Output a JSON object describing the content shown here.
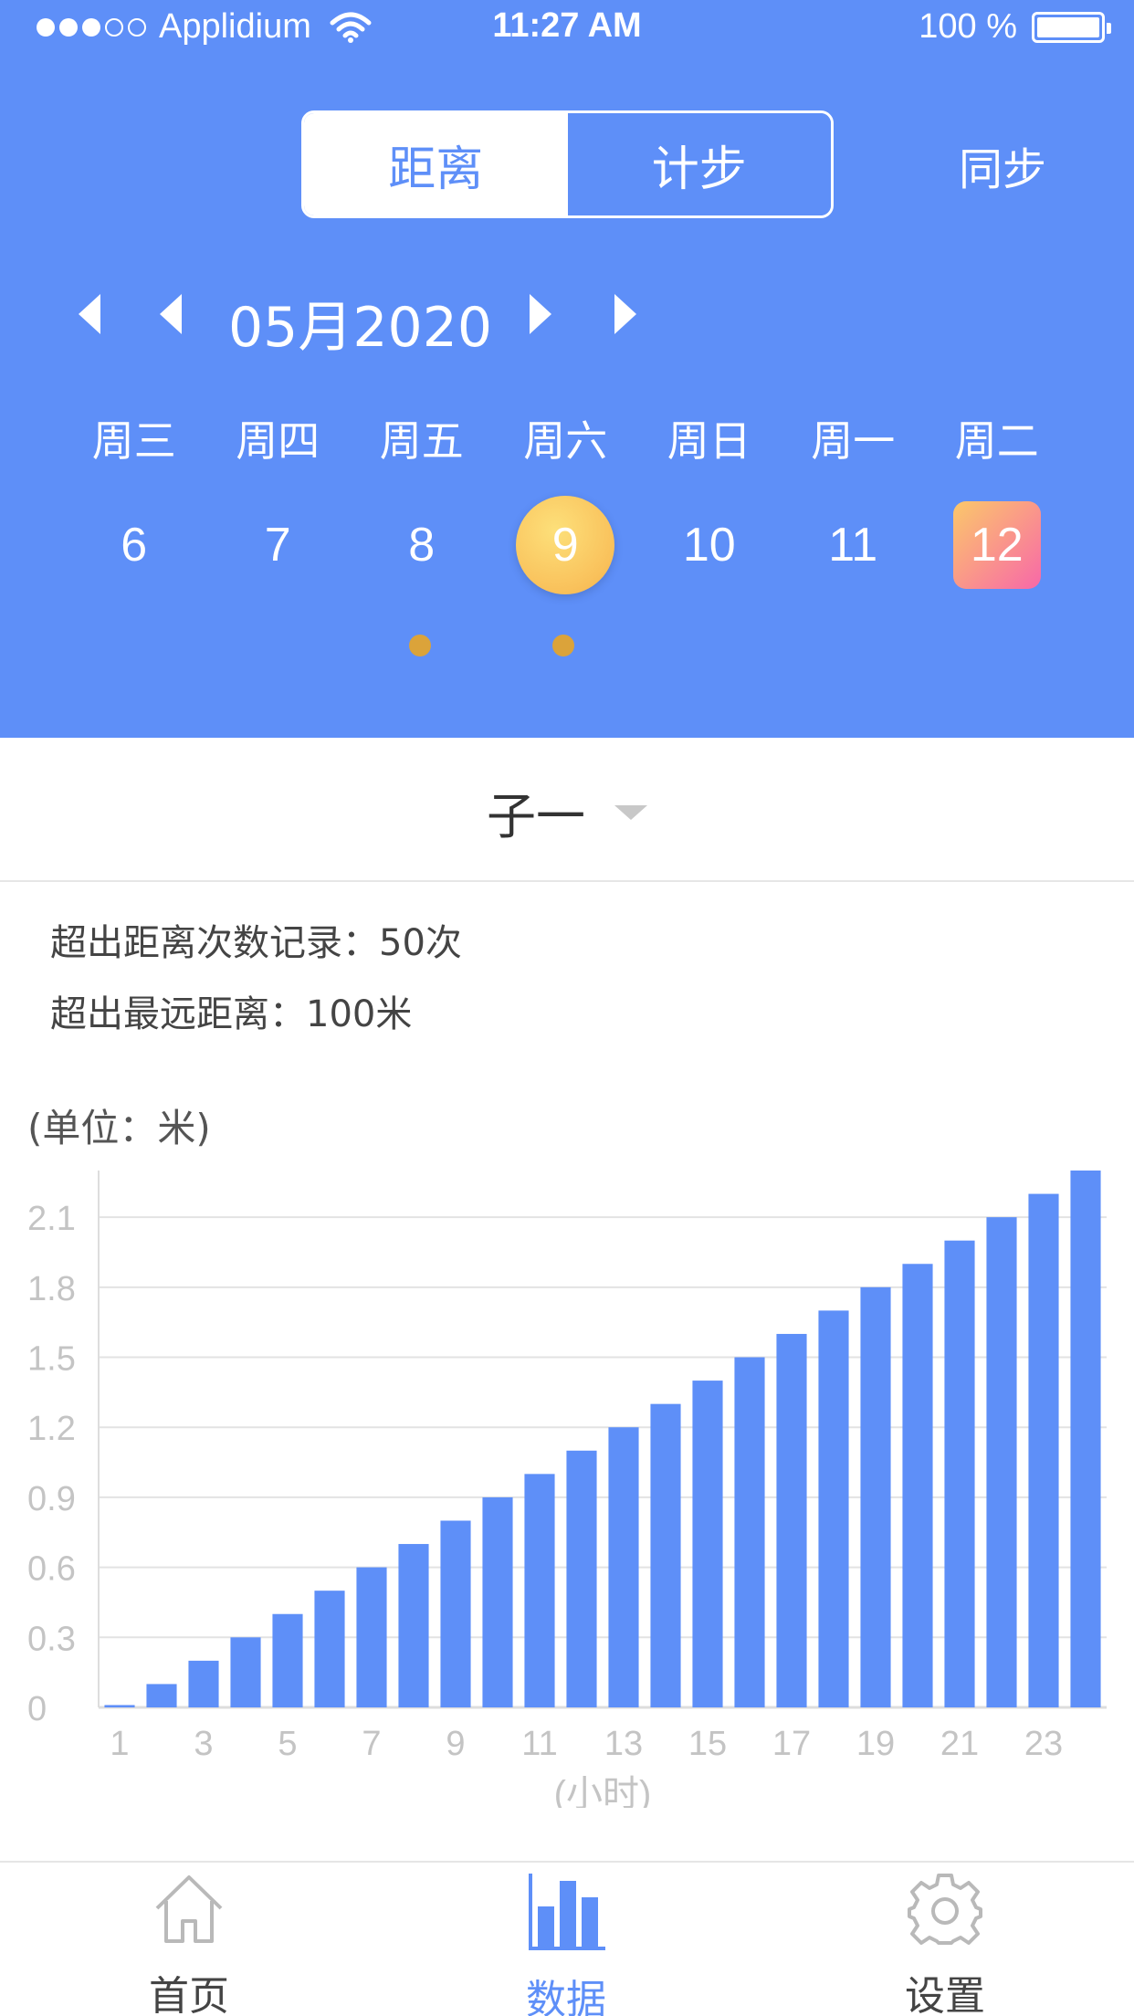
{
  "status_bar": {
    "carrier": "Applidium",
    "time": "11:27 AM",
    "battery": "100 %"
  },
  "segment": {
    "tabs": [
      "距离",
      "计步"
    ],
    "active_index": 0
  },
  "sync_label": "同步",
  "month_label": "05月2020",
  "weekdays": [
    "周三",
    "周四",
    "周五",
    "周六",
    "周日",
    "周一",
    "周二"
  ],
  "days": [
    "6",
    "7",
    "8",
    "9",
    "10",
    "11",
    "12"
  ],
  "selected_day": "9",
  "today_day": "12",
  "marked_days": [
    "8",
    "9"
  ],
  "selector": {
    "name": "子一"
  },
  "stats": {
    "exceed_count": "超出距离次数记录：50次",
    "max_distance": "超出最远距离：100米"
  },
  "unit_label": "(单位：米)",
  "colors": {
    "brand": "#5e8ff8",
    "bar": "#5e8ff8",
    "marker": "#dba33a",
    "grid": "#e3e3e3",
    "tick": "#c4c4c4"
  },
  "chart_data": {
    "type": "bar",
    "xlabel": "(小时)",
    "ylabel": "",
    "ylim": [
      0,
      2.3
    ],
    "yticks": [
      0,
      0.3,
      0.6,
      0.9,
      1.2,
      1.5,
      1.8,
      2.1
    ],
    "ytick_labels": [
      "0",
      "0.3",
      "0.6",
      "0.9",
      "1.2",
      "1.5",
      "1.8",
      "2.1"
    ],
    "categories": [
      "1",
      "2",
      "3",
      "4",
      "5",
      "6",
      "7",
      "8",
      "9",
      "10",
      "11",
      "12",
      "13",
      "14",
      "15",
      "16",
      "17",
      "18",
      "19",
      "20",
      "21",
      "22",
      "23",
      "24"
    ],
    "xtick_labels": [
      "1",
      "3",
      "5",
      "7",
      "9",
      "11",
      "13",
      "15",
      "17",
      "19",
      "21",
      "23"
    ],
    "values": [
      0.01,
      0.1,
      0.2,
      0.3,
      0.4,
      0.5,
      0.6,
      0.7,
      0.8,
      0.9,
      1.0,
      1.1,
      1.2,
      1.3,
      1.4,
      1.5,
      1.6,
      1.7,
      1.8,
      1.9,
      2.0,
      2.1,
      2.2,
      2.3
    ],
    "grid": true
  },
  "tabbar": {
    "items": [
      {
        "label": "首页",
        "icon": "home-icon",
        "active": false
      },
      {
        "label": "数据",
        "icon": "bar-chart-icon",
        "active": true
      },
      {
        "label": "设置",
        "icon": "gear-icon",
        "active": false
      }
    ]
  }
}
